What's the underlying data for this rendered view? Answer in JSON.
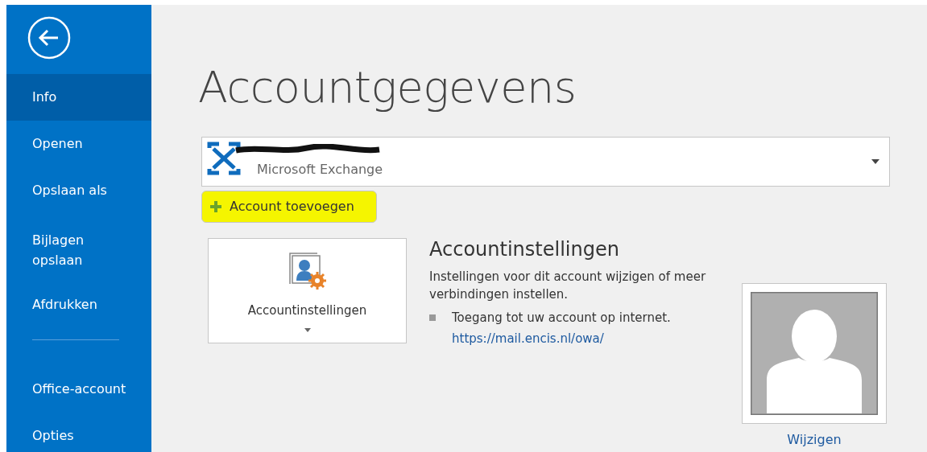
{
  "sidebar": {
    "items": [
      {
        "label": "Info",
        "selected": true,
        "kind": "item"
      },
      {
        "label": "Openen",
        "selected": false,
        "kind": "item"
      },
      {
        "label": "Opslaan als",
        "selected": false,
        "kind": "item"
      },
      {
        "label": "Bijlagen opslaan",
        "selected": false,
        "kind": "item"
      },
      {
        "label": "Afdrukken",
        "selected": false,
        "kind": "item"
      },
      {
        "kind": "divider"
      },
      {
        "label": "Office-account",
        "selected": false,
        "kind": "item"
      },
      {
        "label": "Opties",
        "selected": false,
        "kind": "item"
      }
    ]
  },
  "page_title": "Accountgegevens",
  "account_selector": {
    "account_type": "Microsoft Exchange",
    "name_redacted": true
  },
  "add_account_button": {
    "label": "Account toevoegen",
    "highlighted": true
  },
  "account_settings": {
    "tile_label": "Accountinstellingen",
    "heading": "Accountinstellingen",
    "description": "Instellingen voor dit account wijzigen of meer verbindingen instellen.",
    "bullets": [
      {
        "text": "Toegang tot uw account op internet.",
        "link": "https://mail.encis.nl/owa/"
      }
    ]
  },
  "profile_photo": {
    "change_link": "Wijzigen"
  }
}
